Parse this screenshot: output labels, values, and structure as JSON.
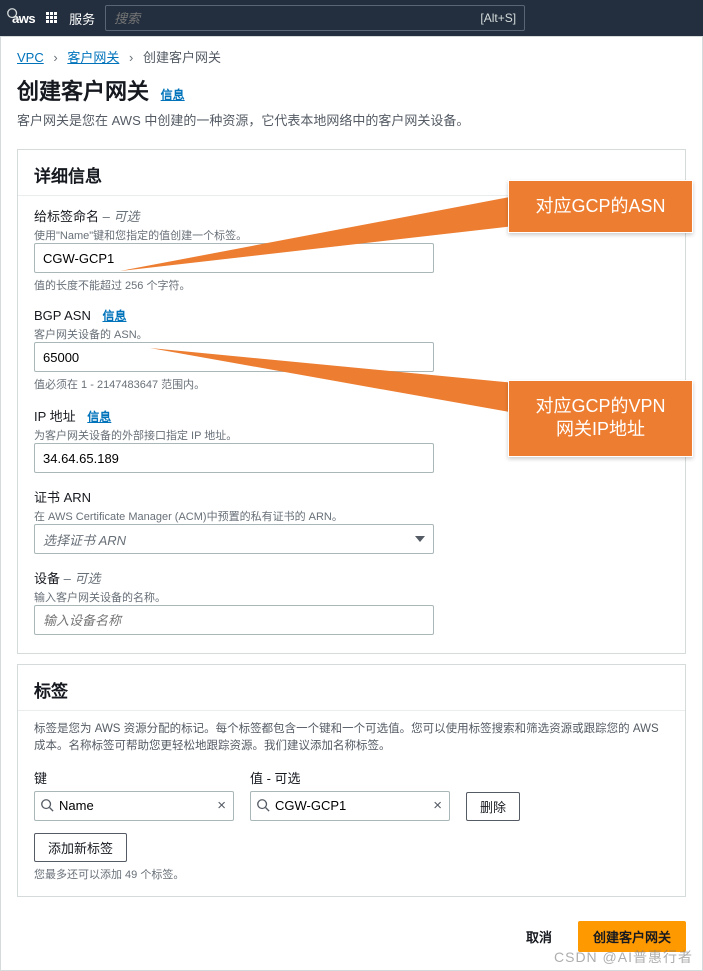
{
  "topnav": {
    "services": "服务",
    "search_placeholder": "搜索",
    "shortcut": "[Alt+S]"
  },
  "breadcrumb": {
    "vpc": "VPC",
    "cgw": "客户网关",
    "current": "创建客户网关"
  },
  "header": {
    "title": "创建客户网关",
    "info": "信息",
    "desc": "客户网关是您在 AWS 中创建的一种资源，它代表本地网络中的客户网关设备。"
  },
  "details": {
    "title": "详细信息",
    "name_tag": {
      "label": "给标签命名",
      "optional": " – 可选",
      "desc": "使用\"Name\"键和您指定的值创建一个标签。",
      "value": "CGW-GCP1",
      "help": "值的长度不能超过 256 个字符。"
    },
    "bgp": {
      "label": "BGP ASN",
      "info": "信息",
      "desc": "客户网关设备的 ASN。",
      "value": "65000",
      "help": "值必须在 1 - 2147483647 范围内。"
    },
    "ip": {
      "label": "IP 地址",
      "info": "信息",
      "desc": "为客户网关设备的外部接口指定 IP 地址。",
      "value": "34.64.65.189"
    },
    "cert": {
      "label": "证书 ARN",
      "desc": "在 AWS Certificate Manager (ACM)中预置的私有证书的 ARN。",
      "placeholder": "选择证书 ARN"
    },
    "device": {
      "label": "设备",
      "optional": " – 可选",
      "desc": "输入客户网关设备的名称。",
      "placeholder": "输入设备名称"
    }
  },
  "tags": {
    "title": "标签",
    "desc": "标签是您为 AWS 资源分配的标记。每个标签都包含一个键和一个可选值。您可以使用标签搜索和筛选资源或跟踪您的 AWS 成本。名称标签可帮助您更轻松地跟踪资源。我们建议添加名称标签。",
    "key_label": "键",
    "value_label": "值 - 可选",
    "key_value": "Name",
    "val_value": "CGW-GCP1",
    "remove": "删除",
    "add": "添加新标签",
    "help": "您最多还可以添加 49 个标签。"
  },
  "actions": {
    "cancel": "取消",
    "create": "创建客户网关"
  },
  "callouts": {
    "asn": "对应GCP的ASN",
    "vpn": "对应GCP的VPN网关IP地址"
  },
  "watermark": "CSDN @AI普惠行者"
}
